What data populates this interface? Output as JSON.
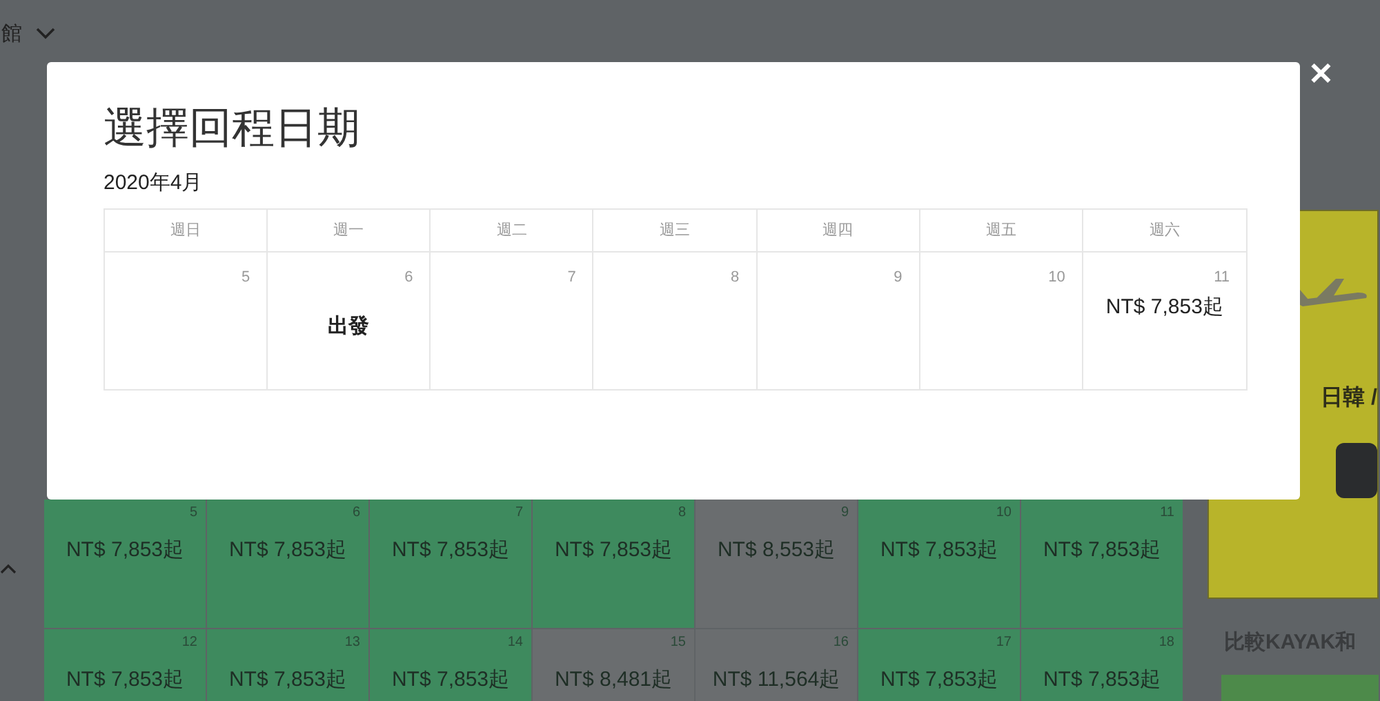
{
  "background": {
    "top_link": "館",
    "weeks": [
      [
        {
          "day": "5",
          "price": "NT$ 7,853起",
          "highlighted": true
        },
        {
          "day": "6",
          "price": "NT$ 7,853起",
          "highlighted": true
        },
        {
          "day": "7",
          "price": "NT$ 7,853起",
          "highlighted": true
        },
        {
          "day": "8",
          "price": "NT$ 7,853起",
          "highlighted": true
        },
        {
          "day": "9",
          "price": "NT$ 8,553起",
          "highlighted": false
        },
        {
          "day": "10",
          "price": "NT$ 7,853起",
          "highlighted": true
        },
        {
          "day": "11",
          "price": "NT$ 7,853起",
          "highlighted": true
        }
      ],
      [
        {
          "day": "12",
          "price": "NT$ 7,853起",
          "highlighted": true
        },
        {
          "day": "13",
          "price": "NT$ 7,853起",
          "highlighted": true
        },
        {
          "day": "14",
          "price": "NT$ 7,853起",
          "highlighted": true
        },
        {
          "day": "15",
          "price": "NT$ 8,481起",
          "highlighted": false
        },
        {
          "day": "16",
          "price": "NT$ 11,564起",
          "highlighted": false
        },
        {
          "day": "17",
          "price": "NT$ 7,853起",
          "highlighted": true
        },
        {
          "day": "18",
          "price": "NT$ 7,853起",
          "highlighted": true
        }
      ]
    ],
    "ad": {
      "text": "日韓 /"
    },
    "compare_heading": "比較KAYAK和"
  },
  "modal": {
    "title": "選擇回程日期",
    "month": "2020年4月",
    "weekdays": [
      "週日",
      "週一",
      "週二",
      "週三",
      "週四",
      "週五",
      "週六"
    ],
    "days": [
      {
        "day": "5"
      },
      {
        "day": "6",
        "label": "出發"
      },
      {
        "day": "7"
      },
      {
        "day": "8"
      },
      {
        "day": "9"
      },
      {
        "day": "10"
      },
      {
        "day": "11",
        "price": "NT$ 7,853起"
      }
    ],
    "close": "✕"
  }
}
